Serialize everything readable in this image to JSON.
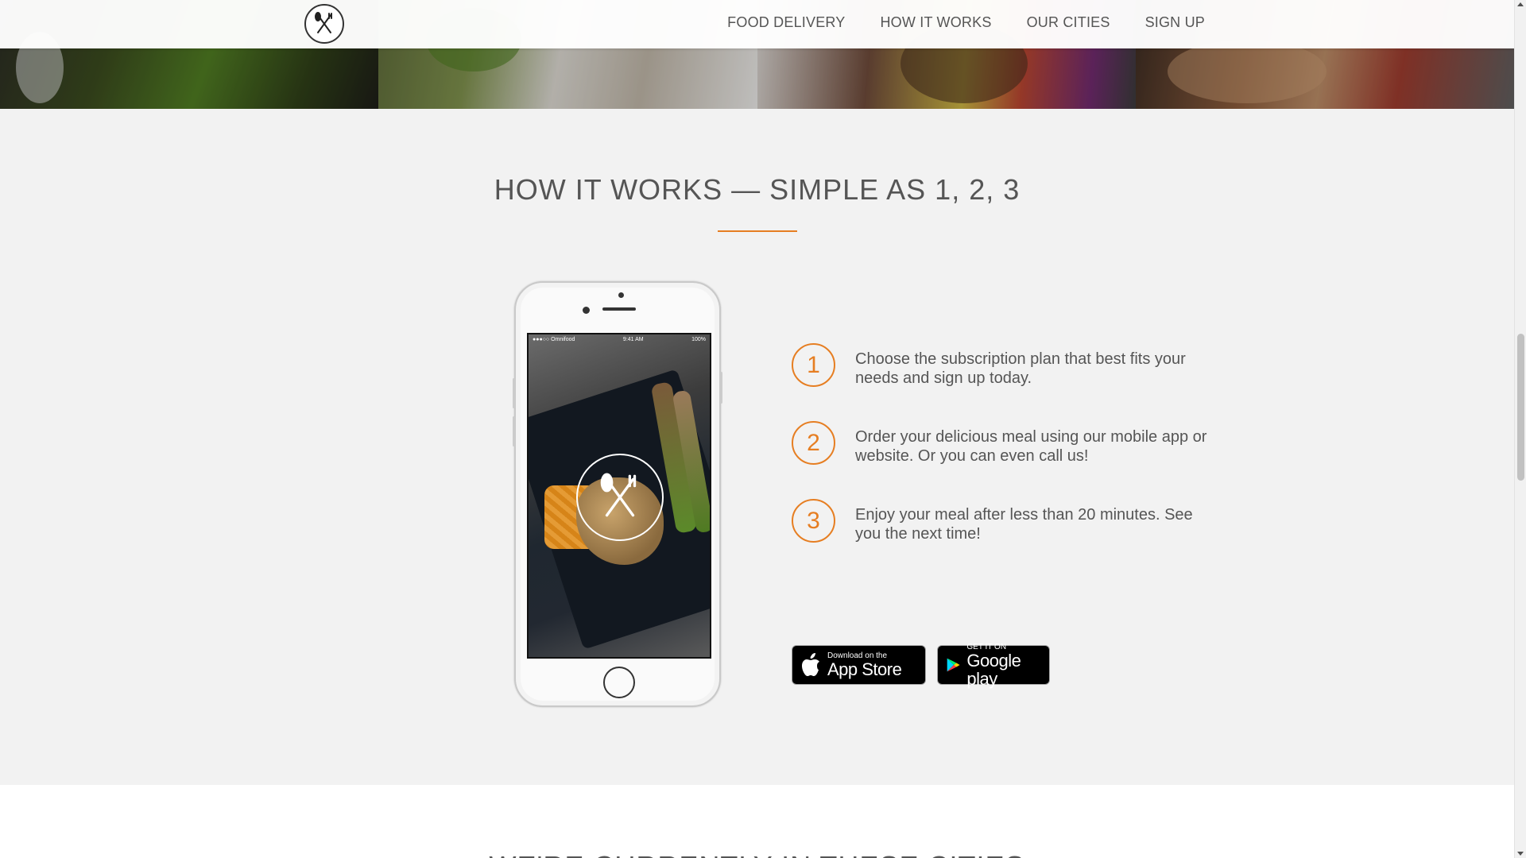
{
  "nav": {
    "links": [
      {
        "label": "FOOD DELIVERY"
      },
      {
        "label": "HOW IT WORKS"
      },
      {
        "label": "OUR CITIES"
      },
      {
        "label": "SIGN UP"
      }
    ]
  },
  "photo_strip": {
    "icons": [
      "green-beans-photo",
      "salad-photo",
      "burger-photo",
      "granola-photo"
    ]
  },
  "how_it_works": {
    "title": "HOW IT WORKS — SIMPLE AS 1, 2, 3",
    "phone": {
      "status_left": "●●●○○ Omnifood",
      "status_time": "9:41 AM",
      "status_right": "100%"
    },
    "steps": [
      {
        "number": "1",
        "text": "Choose the subscription plan that best fits your needs and sign up today."
      },
      {
        "number": "2",
        "text": "Order your delicious meal using our mobile app or website. Or you can even call us!"
      },
      {
        "number": "3",
        "text": "Enjoy your meal after less than 20 minutes. See you the next time!"
      }
    ],
    "badges": {
      "apple": {
        "small": "Download on the",
        "big": "App Store",
        "icon": "apple-icon"
      },
      "google": {
        "small": "GET IT ON",
        "big": "Google play",
        "icon": "google-play-icon"
      }
    }
  },
  "next_section": {
    "title": "WE'RE CURRENTLY IN THESE CITIES"
  },
  "colors": {
    "accent": "#e67e22",
    "background": "#f2f2f2",
    "text": "#555555"
  }
}
